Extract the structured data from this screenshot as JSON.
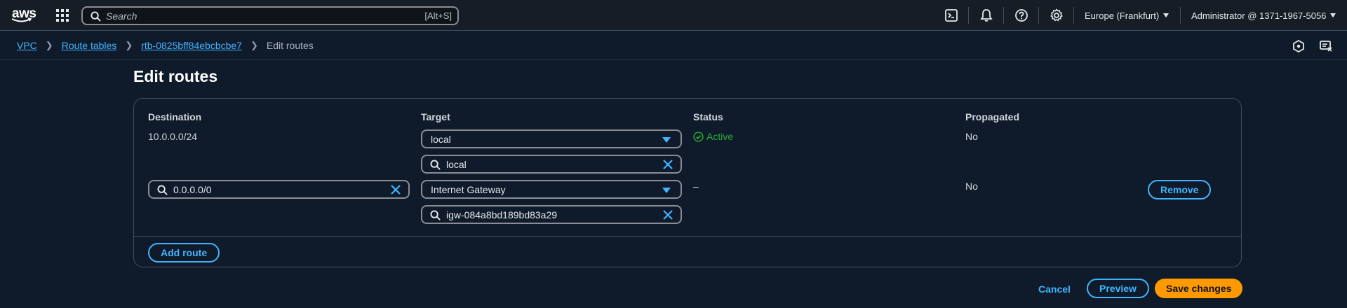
{
  "nav": {
    "logo_text": "aws",
    "search_placeholder": "Search",
    "search_shortcut": "[Alt+S]",
    "region": "Europe (Frankfurt)",
    "account": "Administrator @ 1371-1967-5056"
  },
  "breadcrumb": {
    "items": [
      "VPC",
      "Route tables",
      "rtb-0825bff84ebcbcbe7"
    ],
    "current": "Edit routes"
  },
  "page": {
    "title": "Edit routes"
  },
  "table": {
    "headers": {
      "destination": "Destination",
      "target": "Target",
      "status": "Status",
      "propagated": "Propagated"
    },
    "rows": [
      {
        "destination": "10.0.0.0/24",
        "target_type": "local",
        "target_value": "local",
        "status": "Active",
        "propagated": "No"
      },
      {
        "destination": "0.0.0.0/0",
        "target_type": "Internet Gateway",
        "target_value": "igw-084a8bd189bd83a29",
        "status": "–",
        "propagated": "No",
        "remove_label": "Remove"
      }
    ]
  },
  "actions": {
    "add_route": "Add route",
    "cancel": "Cancel",
    "preview": "Preview",
    "save": "Save changes"
  },
  "colors": {
    "background": "#0f1b2a",
    "link": "#42b4ff",
    "primary": "#ff9900",
    "success": "#29ad32"
  }
}
